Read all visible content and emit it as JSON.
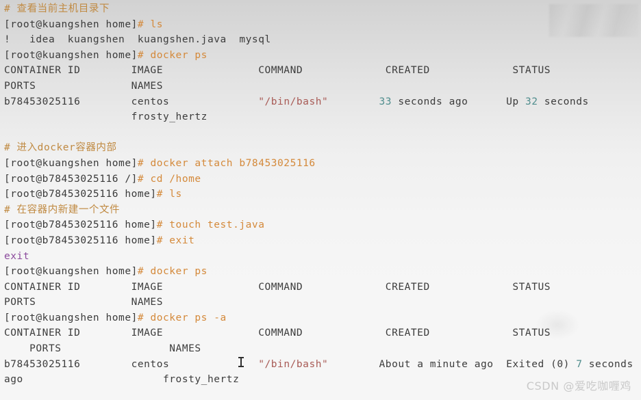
{
  "terminal": {
    "colors": {
      "comment": "#c08a42",
      "prompt": "#3a3a3a",
      "command": "#d4893a",
      "output": "#3c3c3c",
      "string_red": "#a85a55",
      "number_teal": "#4f8d8d",
      "exit_purple": "#8b4a9c",
      "background_top": "#d2d2d2",
      "background_bottom": "#f6f6f6",
      "watermark": "#c9c9c9"
    },
    "host_prompt": "[root@kuangshen home]",
    "container_prompt_root": "[root@b78453025116 /]",
    "container_prompt_home": "[root@b78453025116 home]",
    "hash": "#",
    "lines": [
      {
        "id": "comment-1",
        "type": "comment",
        "hash": "# ",
        "text": "查看当前主机目录下"
      },
      {
        "id": "cmd-ls-host",
        "type": "command",
        "prompt": "[root@kuangshen home]",
        "hash": "# ",
        "command": "ls"
      },
      {
        "id": "ls-output",
        "type": "output",
        "text": "!   idea  kuangshen  kuangshen.java  mysql"
      },
      {
        "id": "cmd-docker-ps-1",
        "type": "command",
        "prompt": "[root@kuangshen home]",
        "hash": "# ",
        "command": "docker ps"
      },
      {
        "id": "hdr1-line1",
        "type": "output",
        "text": "CONTAINER ID        IMAGE               COMMAND             CREATED             STATUS"
      },
      {
        "id": "hdr1-line2",
        "type": "output",
        "text": "PORTS               NAMES"
      },
      {
        "id": "row1-line1",
        "type": "row",
        "segments": [
          {
            "text": "b78453025116        centos              ",
            "style": "out"
          },
          {
            "text": "\"/bin/bash\"",
            "style": "red"
          },
          {
            "text": "        ",
            "style": "out"
          },
          {
            "text": "33",
            "style": "num"
          },
          {
            "text": " seconds ago      Up ",
            "style": "out"
          },
          {
            "text": "32",
            "style": "num"
          },
          {
            "text": " seconds",
            "style": "out"
          }
        ]
      },
      {
        "id": "row1-line2",
        "type": "output",
        "text": "                    frosty_hertz"
      },
      {
        "id": "blank-1",
        "type": "blank",
        "text": ""
      },
      {
        "id": "comment-2",
        "type": "comment",
        "hash": "# ",
        "text": "进入docker容器内部"
      },
      {
        "id": "cmd-attach",
        "type": "command",
        "prompt": "[root@kuangshen home]",
        "hash": "# ",
        "command": "docker attach b78453025116"
      },
      {
        "id": "cmd-cd-home",
        "type": "command",
        "prompt": "[root@b78453025116 /]",
        "hash": "# ",
        "command": "cd /home"
      },
      {
        "id": "cmd-ls-container",
        "type": "command",
        "prompt": "[root@b78453025116 home]",
        "hash": "# ",
        "command": "ls"
      },
      {
        "id": "comment-3",
        "type": "comment",
        "hash": "# ",
        "text": "在容器内新建一个文件"
      },
      {
        "id": "cmd-touch",
        "type": "command",
        "prompt": "[root@b78453025116 home]",
        "hash": "# ",
        "command": "touch test.java"
      },
      {
        "id": "cmd-exit",
        "type": "command",
        "prompt": "[root@b78453025116 home]",
        "hash": "# ",
        "command": "exit"
      },
      {
        "id": "exit-output",
        "type": "exit",
        "text": "exit"
      },
      {
        "id": "cmd-docker-ps-2",
        "type": "command",
        "prompt": "[root@kuangshen home]",
        "hash": "# ",
        "command": "docker ps"
      },
      {
        "id": "hdr2-line1",
        "type": "output",
        "text": "CONTAINER ID        IMAGE               COMMAND             CREATED             STATUS"
      },
      {
        "id": "hdr2-line2",
        "type": "output",
        "text": "PORTS               NAMES"
      },
      {
        "id": "cmd-docker-ps-a",
        "type": "command",
        "prompt": "[root@kuangshen home]",
        "hash": "# ",
        "command": "docker ps -a"
      },
      {
        "id": "hdr3-line1",
        "type": "output",
        "text": "CONTAINER ID        IMAGE               COMMAND             CREATED             STATUS"
      },
      {
        "id": "hdr3-line2",
        "type": "output",
        "text": "    PORTS                 NAMES"
      },
      {
        "id": "row2-line1",
        "type": "row",
        "segments": [
          {
            "text": "b78453025116        centos              ",
            "style": "out"
          },
          {
            "text": "\"/bin/bash\"",
            "style": "red"
          },
          {
            "text": "        About a minute ago  Exited (0) ",
            "style": "out"
          },
          {
            "text": "7",
            "style": "num"
          },
          {
            "text": " seconds",
            "style": "out"
          }
        ]
      },
      {
        "id": "row2-line2",
        "type": "output",
        "text": "ago                      frosty_hertz"
      }
    ]
  },
  "watermark": {
    "text": "CSDN @爱吃咖喱鸡"
  }
}
